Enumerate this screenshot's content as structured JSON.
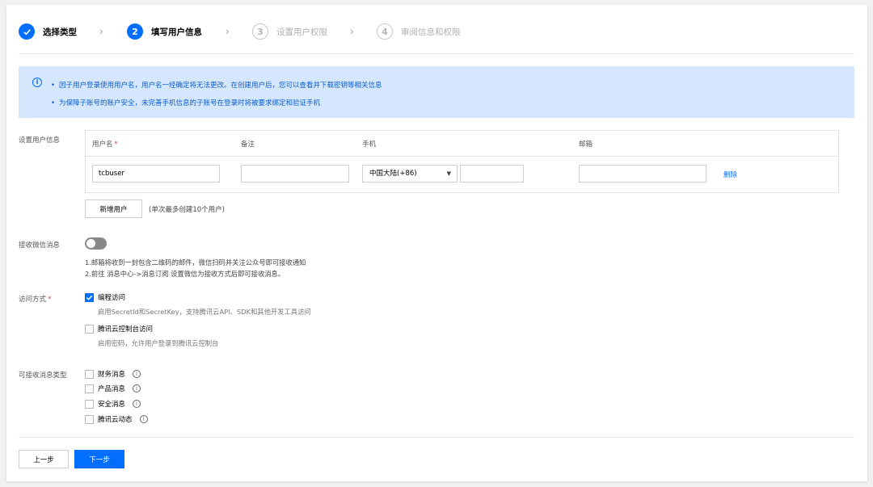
{
  "steps": [
    {
      "label": "选择类型",
      "num": "✓",
      "state": "done"
    },
    {
      "label": "填写用户信息",
      "num": "2",
      "state": "current"
    },
    {
      "label": "设置用户权限",
      "num": "3",
      "state": "todo"
    },
    {
      "label": "审阅信息和权限",
      "num": "4",
      "state": "todo"
    }
  ],
  "banner": {
    "line1": "因子用户登录使用用户名，用户名一经确定将无法更改。在创建用户后，您可以查看并下载密钥等相关信息",
    "line2": "为保障子账号的账户安全，未完善手机信息的子账号在登录时将被要求绑定和验证手机"
  },
  "user_info": {
    "section_label": "设置用户信息",
    "columns": {
      "username": "用户名",
      "remark": "备注",
      "phone": "手机",
      "email": "邮箱"
    },
    "row": {
      "username": "tcbuser",
      "remark": "",
      "phone_region": "中国大陆(+86)",
      "phone_number": "",
      "email": "",
      "delete_label": "删除"
    },
    "add_button": "新增用户",
    "add_hint": "(单次最多创建10个用户)"
  },
  "wechat": {
    "label": "接收微信消息",
    "enabled": false,
    "note1": "1.邮箱将收到一封包含二维码的邮件，微信扫码并关注公众号即可接收通知",
    "note2": "2.前往 消息中心->消息订阅 设置微信为接收方式后即可接收消息。"
  },
  "access": {
    "label": "访问方式",
    "options": [
      {
        "label": "编程访问",
        "desc": "启用SecretId和SecretKey，支持腾讯云API、SDK和其他开发工具访问",
        "checked": true
      },
      {
        "label": "腾讯云控制台访问",
        "desc": "启用密码，允许用户登录到腾讯云控制台",
        "checked": false
      }
    ]
  },
  "messages": {
    "label": "可接收消息类型",
    "options": [
      {
        "label": "财务消息",
        "checked": false
      },
      {
        "label": "产品消息",
        "checked": false
      },
      {
        "label": "安全消息",
        "checked": false
      },
      {
        "label": "腾讯云动态",
        "checked": false
      }
    ]
  },
  "footer": {
    "prev": "上一步",
    "next": "下一步"
  },
  "colors": {
    "primary": "#006eff",
    "banner_bg": "#d5e7fd",
    "required": "#e54545"
  }
}
